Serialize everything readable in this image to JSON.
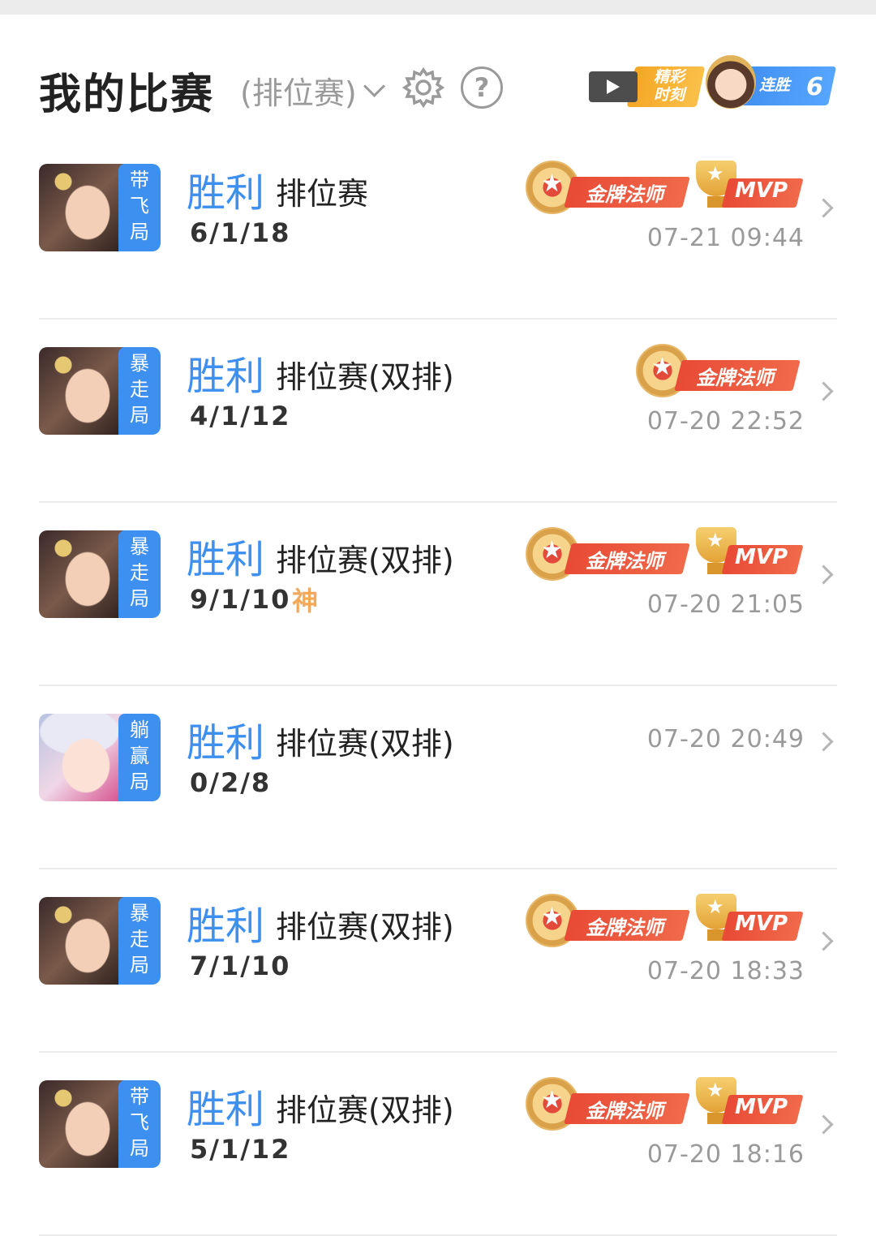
{
  "header": {
    "title": "我的比赛",
    "filter_label": "(排位赛)",
    "highlight_label": "精彩\n时刻",
    "streak_label": "连胜",
    "streak_count": "6"
  },
  "matches": [
    {
      "result": "胜利",
      "mode": "排位赛",
      "kda": "6/1/18",
      "tag": "带\n飞\n局",
      "time": "07-21 09:44",
      "god": "",
      "badges": [
        "金牌法师",
        "MVP"
      ],
      "hero": "hero-a"
    },
    {
      "result": "胜利",
      "mode": "排位赛(双排)",
      "kda": "4/1/12",
      "tag": "暴\n走\n局",
      "time": "07-20 22:52",
      "god": "",
      "badges": [
        "金牌法师"
      ],
      "hero": "hero-a"
    },
    {
      "result": "胜利",
      "mode": "排位赛(双排)",
      "kda": "9/1/10",
      "tag": "暴\n走\n局",
      "time": "07-20 21:05",
      "god": "神",
      "badges": [
        "金牌法师",
        "MVP"
      ],
      "hero": "hero-a"
    },
    {
      "result": "胜利",
      "mode": "排位赛(双排)",
      "kda": "0/2/8",
      "tag": "躺\n赢\n局",
      "time": "07-20 20:49",
      "god": "",
      "badges": [],
      "hero": "hero-b"
    },
    {
      "result": "胜利",
      "mode": "排位赛(双排)",
      "kda": "7/1/10",
      "tag": "暴\n走\n局",
      "time": "07-20 18:33",
      "god": "",
      "badges": [
        "金牌法师",
        "MVP"
      ],
      "hero": "hero-a"
    },
    {
      "result": "胜利",
      "mode": "排位赛(双排)",
      "kda": "5/1/12",
      "tag": "带\n飞\n局",
      "time": "07-20 18:16",
      "god": "",
      "badges": [
        "金牌法师",
        "MVP"
      ],
      "hero": "hero-a"
    }
  ],
  "icons": {
    "gear": "gear-icon",
    "help": "help-icon",
    "video": "video-icon",
    "chevron": "chevron-right-icon"
  },
  "colors": {
    "accent_blue": "#3d8ff0",
    "badge_red": "#e84a36",
    "gold": "#e3a236",
    "muted": "#9a9a9a"
  }
}
